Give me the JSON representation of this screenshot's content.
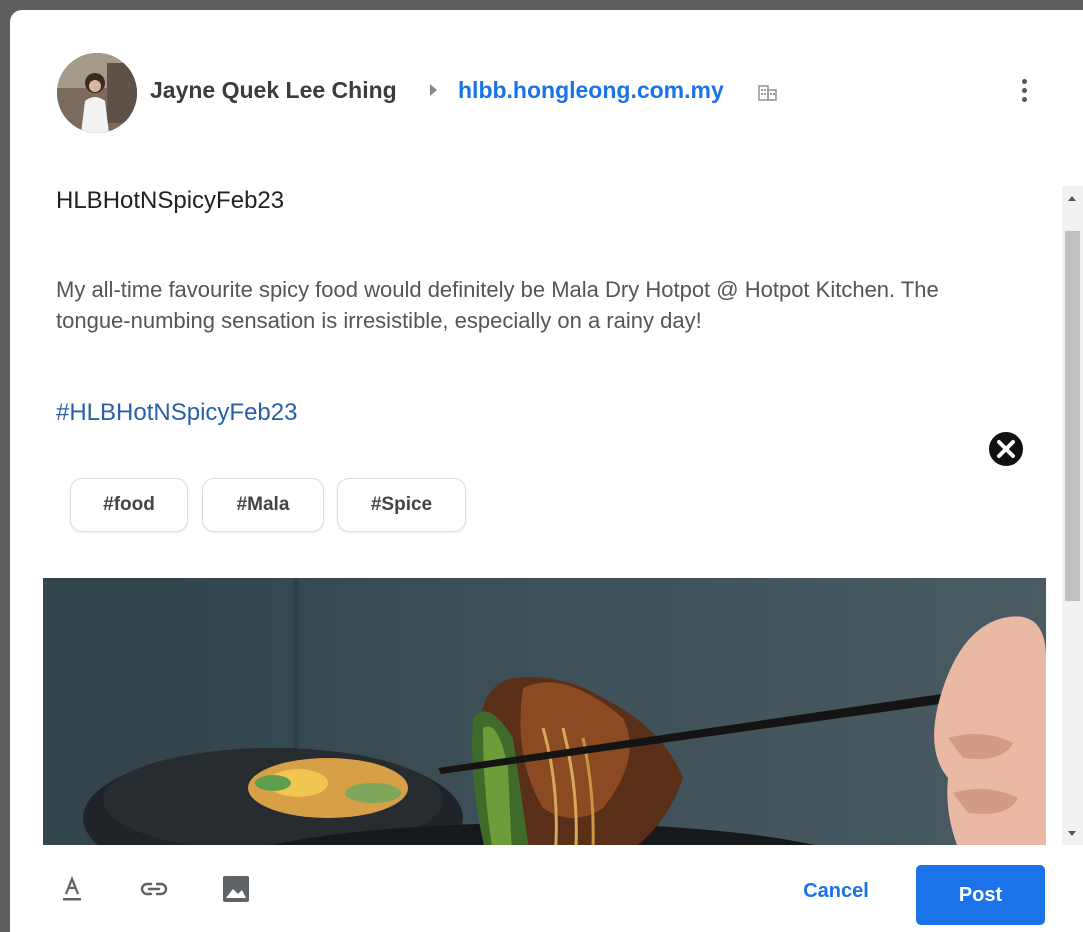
{
  "header": {
    "author": "Jayne Quek Lee Ching",
    "target": "hlbb.hongleong.com.my"
  },
  "post": {
    "title": "HLBHotNSpicyFeb23",
    "body": "My all-time favourite spicy food would definitely be Mala Dry Hotpot @ Hotpot Kitchen. The tongue-numbing sensation is irresistible, especially on a rainy day!",
    "hashtag": "#HLBHotNSpicyFeb23",
    "chips": [
      "#food",
      "#Mala",
      "#Spice"
    ]
  },
  "footer": {
    "tools": [
      "text-format-icon",
      "link-icon",
      "image-icon"
    ],
    "cancel_label": "Cancel",
    "post_label": "Post"
  },
  "colors": {
    "accent": "#1a73e8",
    "hashtag": "#2b5fa8"
  }
}
